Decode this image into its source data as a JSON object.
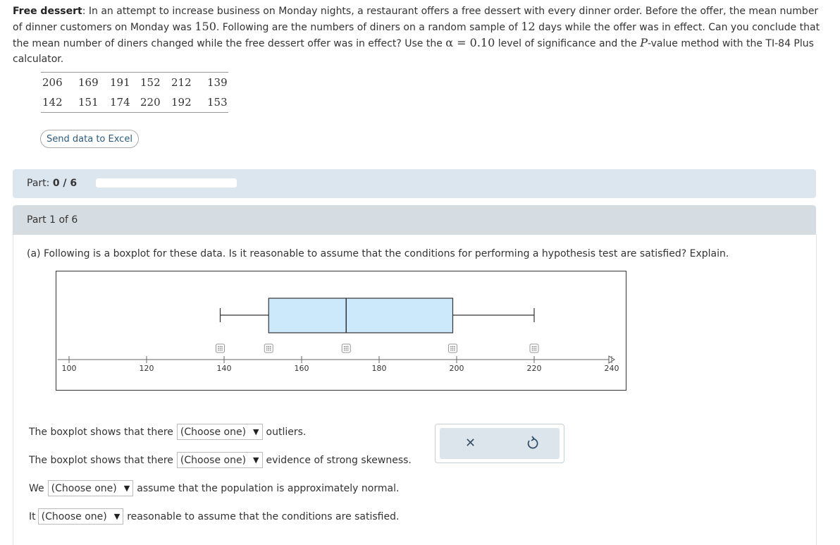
{
  "problem": {
    "title": "Free dessert",
    "text_1": ": In an attempt to increase business on Monday nights, a restaurant offers a free dessert with every dinner order. Before the offer, the mean number of dinner customers on Monday was ",
    "value_mean": "150",
    "text_2": ". Following are the numbers of diners on a random sample of ",
    "value_n": "12",
    "text_3": " days while the offer was in effect. Can you conclude that the mean number of diners changed while the free dessert offer was in effect? Use the ",
    "alpha": "α = 0.10",
    "text_4": " level of significance and the ",
    "p_letter": "P",
    "text_5": "-value method with the TI-84 Plus calculator."
  },
  "data_rows": [
    [
      "206",
      "169",
      "191",
      "152",
      "212",
      "139"
    ],
    [
      "142",
      "151",
      "174",
      "220",
      "192",
      "153"
    ]
  ],
  "excel_button": "Send data to Excel",
  "progress": {
    "label": "Part:",
    "value": "0 / 6",
    "fraction": 0
  },
  "part_header": "Part 1 of 6",
  "question": "(a) Following is a boxplot for these data. Is it reasonable to assume that the conditions for performing a hypothesis test are satisfied? Explain.",
  "chart_data": {
    "type": "boxplot",
    "min": 139,
    "q1": 151.5,
    "median": 171.5,
    "q3": 199,
    "max": 220,
    "xlim": [
      97,
      240
    ],
    "ticks": [
      100,
      120,
      140,
      160,
      180,
      200,
      220,
      240
    ],
    "tick_labels": [
      "100",
      "120",
      "140",
      "160",
      "180",
      "200",
      "220",
      "240"
    ],
    "box_color": "#cce8fb",
    "markers_at": [
      139,
      151.5,
      171.5,
      199,
      220
    ]
  },
  "answers": [
    {
      "prefix": "The boxplot shows that there",
      "select": "(Choose one)",
      "suffix": "outliers."
    },
    {
      "prefix": "The boxplot shows that there",
      "select": "(Choose one)",
      "suffix": "evidence of strong skewness."
    },
    {
      "prefix": "We",
      "select": "(Choose one)",
      "suffix": "assume that the population is approximately normal."
    },
    {
      "prefix": "It",
      "select": "(Choose one)",
      "suffix": "reasonable to assume that the conditions are satisfied."
    }
  ],
  "icons": {
    "clear": "x-icon",
    "undo": "undo-icon"
  }
}
